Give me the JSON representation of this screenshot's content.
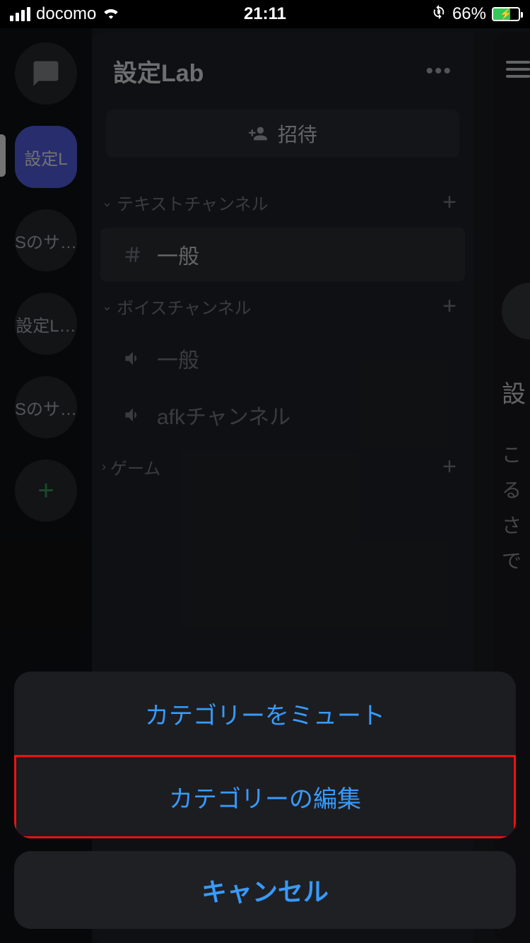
{
  "status": {
    "carrier": "docomo",
    "time": "21:11",
    "battery_pct": "66%"
  },
  "rail": {
    "selected_label": "設定L",
    "items": [
      "Sのサ…",
      "設定L…",
      "Sのサ…"
    ]
  },
  "panel": {
    "title": "設定Lab",
    "invite_label": "招待",
    "cat_text": {
      "label": "テキストチャンネル"
    },
    "text_channels": [
      "一般"
    ],
    "cat_voice": {
      "label": "ボイスチャンネル"
    },
    "voice_channels": [
      "一般",
      "afkチャンネル"
    ],
    "cat_game": {
      "label": "ゲーム"
    }
  },
  "peek": {
    "title_char": "設",
    "body": "こ\nる\nさ\nで"
  },
  "sheet": {
    "mute": "カテゴリーをミュート",
    "edit": "カテゴリーの編集",
    "cancel": "キャンセル"
  }
}
